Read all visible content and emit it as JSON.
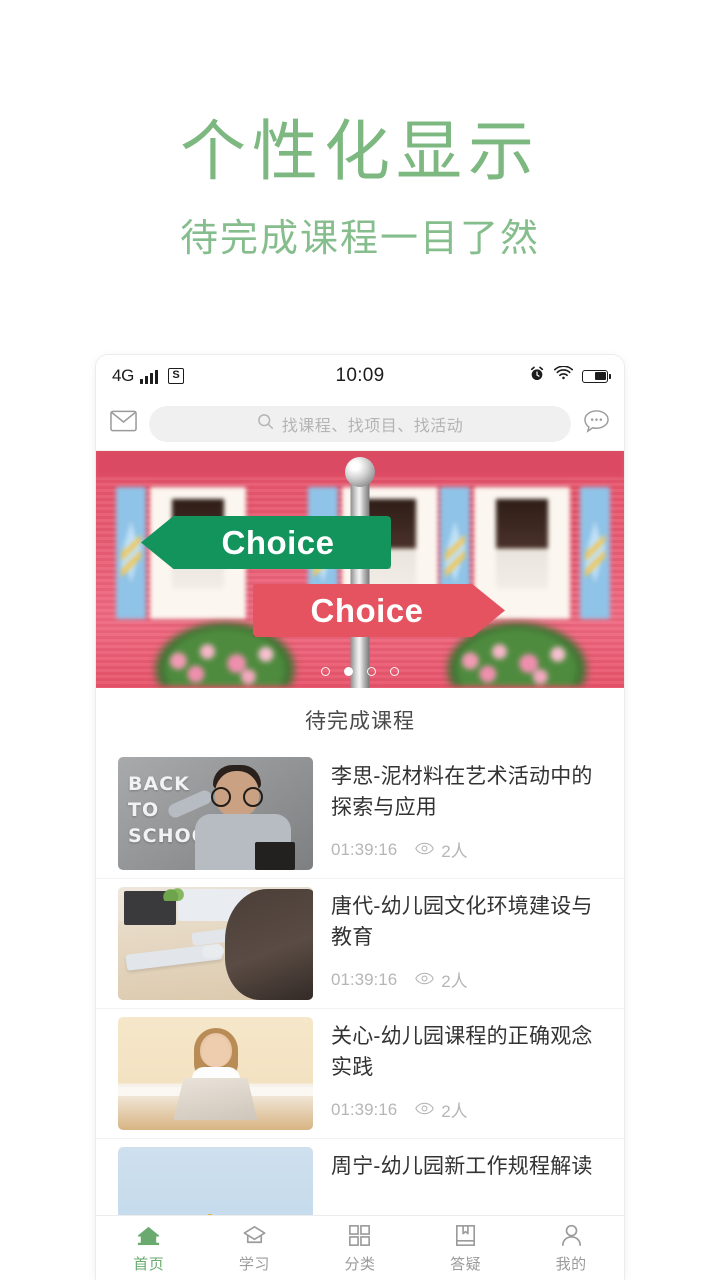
{
  "promo": {
    "title": "个性化显示",
    "subtitle": "待完成课程一目了然",
    "title_color": "#7cb87f",
    "subtitle_color": "#86bd8c"
  },
  "statusbar": {
    "network": "4G",
    "signal_icon": "signal-bars-icon",
    "ime_icon": "sogou-input-icon",
    "ime_letter": "S",
    "time": "10:09",
    "alarm_icon": "alarm-clock-icon",
    "wifi_icon": "wifi-icon",
    "battery_icon": "battery-icon",
    "battery_level": "48"
  },
  "header": {
    "mail_icon": "envelope-icon",
    "search_icon": "search-icon",
    "search_placeholder": "找课程、找项目、找活动",
    "search_value": "",
    "chat_icon": "chat-bubble-icon"
  },
  "banner": {
    "sign_top_text": "Choice",
    "sign_bottom_text": "Choice",
    "sign_top_color": "#13945d",
    "sign_bottom_color": "#e4535f",
    "dots_total": 4,
    "dots_active_index": 1
  },
  "section": {
    "title": "待完成课程"
  },
  "courses": [
    {
      "title": "李思-泥材料在艺术活动中的探索与应用",
      "duration": "01:39:16",
      "views": "2人",
      "views_icon": "eye-icon",
      "thumb": "back-to-school-chalkboard",
      "thumb_text_1": "BACK",
      "thumb_text_2": "TO",
      "thumb_text_3": "SCHOOL"
    },
    {
      "title": "唐代-幼儿园文化环境建设与教育",
      "duration": "01:39:16",
      "views": "2人",
      "views_icon": "eye-icon",
      "thumb": "office-desk-keyboard"
    },
    {
      "title": "关心-幼儿园课程的正确观念实践",
      "duration": "01:39:16",
      "views": "2人",
      "views_icon": "eye-icon",
      "thumb": "girl-with-laptop"
    },
    {
      "title": "周宁-幼儿园新工作规程解读",
      "duration": "",
      "views": "",
      "views_icon": "eye-icon",
      "thumb": "colored-pencils-cup"
    }
  ],
  "tabbar": {
    "active_color": "#6aaa6e",
    "inactive_color": "#9b9b9b",
    "items": [
      {
        "label": "首页",
        "icon": "home-icon",
        "active": true
      },
      {
        "label": "学习",
        "icon": "graduation-cap-icon",
        "active": false
      },
      {
        "label": "分类",
        "icon": "grid-icon",
        "active": false
      },
      {
        "label": "答疑",
        "icon": "book-bookmark-icon",
        "active": false
      },
      {
        "label": "我的",
        "icon": "person-icon",
        "active": false
      }
    ]
  }
}
